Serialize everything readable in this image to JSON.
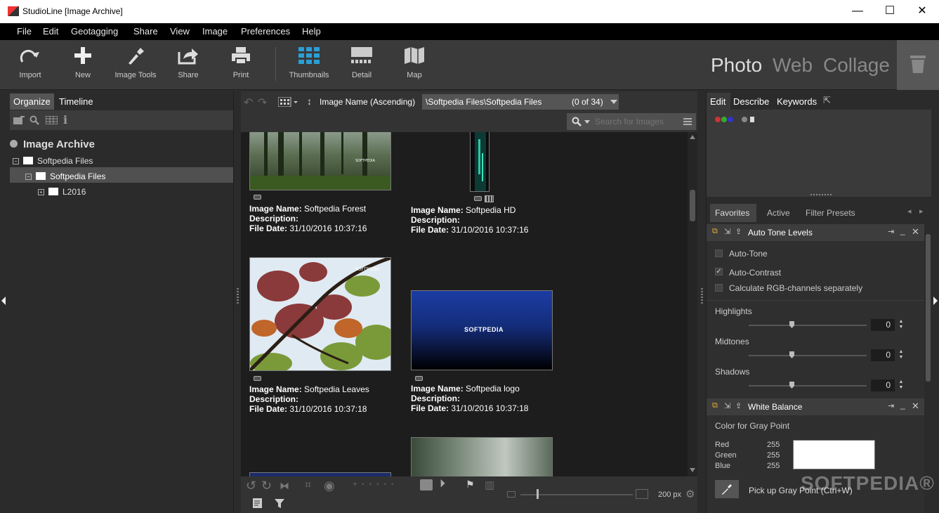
{
  "window": {
    "title": "StudioLine [Image Archive]",
    "minimize": "—",
    "maximize": "☐",
    "close": "✕"
  },
  "menu": [
    "File",
    "Edit",
    "Geotagging",
    "Share",
    "View",
    "Image",
    "Preferences",
    "Help"
  ],
  "toolbar": {
    "import": "Import",
    "new": "New",
    "image_tools": "Image Tools",
    "share": "Share",
    "print": "Print",
    "thumbnails": "Thumbnails",
    "detail": "Detail",
    "map": "Map"
  },
  "modes": {
    "photo": "Photo",
    "web": "Web",
    "collage": "Collage"
  },
  "left": {
    "tabs": [
      "Organize",
      "Timeline"
    ],
    "root": "Image Archive",
    "tree": [
      {
        "label": "Softpedia Files"
      },
      {
        "label": "Softpedia Files"
      },
      {
        "label": "L2016"
      }
    ]
  },
  "center": {
    "sort": "Image Name (Ascending)",
    "path": "\\Softpedia Files\\Softpedia Files",
    "count": "(0 of 34)",
    "search_placeholder": "Search for Images",
    "zoom": "200 px",
    "items": [
      {
        "name": "Softpedia Forest",
        "desc": "",
        "date": "31/10/2016 10:37:16"
      },
      {
        "name": "Softpedia HD",
        "desc": "",
        "date": "31/10/2016 10:37:16"
      },
      {
        "name": "Softpedia Leaves",
        "desc": "",
        "date": "31/10/2016 10:37:18"
      },
      {
        "name": "Softpedia logo",
        "desc": "",
        "date": "31/10/2016 10:37:18"
      }
    ],
    "labels": {
      "name": "Image Name:",
      "desc": "Description:",
      "date": "File Date:"
    },
    "thumb_watermark": "SOFTPEDIA"
  },
  "right": {
    "tabs": [
      "Edit",
      "Describe",
      "Keywords"
    ],
    "subtabs": [
      "Favorites",
      "Active",
      "Filter Presets"
    ],
    "auto_tone": {
      "title": "Auto Tone Levels",
      "options": [
        {
          "label": "Auto-Tone",
          "checked": false
        },
        {
          "label": "Auto-Contrast",
          "checked": true
        },
        {
          "label": "Calculate RGB-channels separately",
          "checked": false
        }
      ],
      "sliders": [
        {
          "label": "Highlights",
          "value": "0"
        },
        {
          "label": "Midtones",
          "value": "0"
        },
        {
          "label": "Shadows",
          "value": "0"
        }
      ]
    },
    "white_balance": {
      "title": "White Balance",
      "gray_label": "Color for Gray Point",
      "channels": [
        {
          "name": "Red",
          "value": "255"
        },
        {
          "name": "Green",
          "value": "255"
        },
        {
          "name": "Blue",
          "value": "255"
        }
      ],
      "pickup": "Pick up Gray Point (Ctrl+W)"
    }
  },
  "watermark": "SOFTPEDIA®"
}
